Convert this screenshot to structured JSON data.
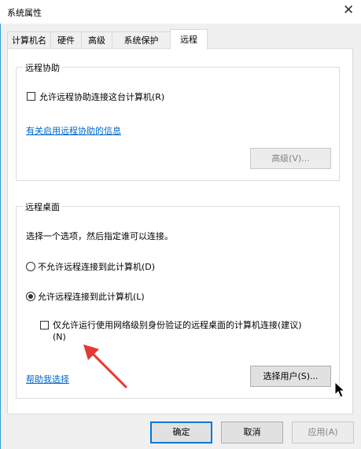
{
  "window": {
    "title": "系统属性",
    "close_glyph": "✕"
  },
  "tabs": [
    {
      "label": "计算机名"
    },
    {
      "label": "硬件"
    },
    {
      "label": "高级"
    },
    {
      "label": "系统保护"
    },
    {
      "label": "远程",
      "active": true
    }
  ],
  "remote_assistance": {
    "legend": "远程协助",
    "allow_label": "允许远程协助连接这台计算机(R)",
    "allow_checked": false,
    "info_link": "有关启用远程协助的信息",
    "advanced_button": "高级(V)..."
  },
  "remote_desktop": {
    "legend": "远程桌面",
    "description": "选择一个选项，然后指定谁可以连接。",
    "option_deny": "不允许远程连接到此计算机(D)",
    "option_allow": "允许远程连接到此计算机(L)",
    "selected": "allow",
    "nla_label_line1": "仅允许运行使用网络级别身份验证的远程桌面的计算机连接(建议)",
    "nla_label_line2": "(N)",
    "nla_checked": false,
    "help_link": "帮助我选择",
    "select_users_button": "选择用户(S)..."
  },
  "footer": {
    "ok": "确定",
    "cancel": "取消",
    "apply": "应用(A)"
  },
  "annotation": {
    "arrow_color": "#e53935"
  }
}
